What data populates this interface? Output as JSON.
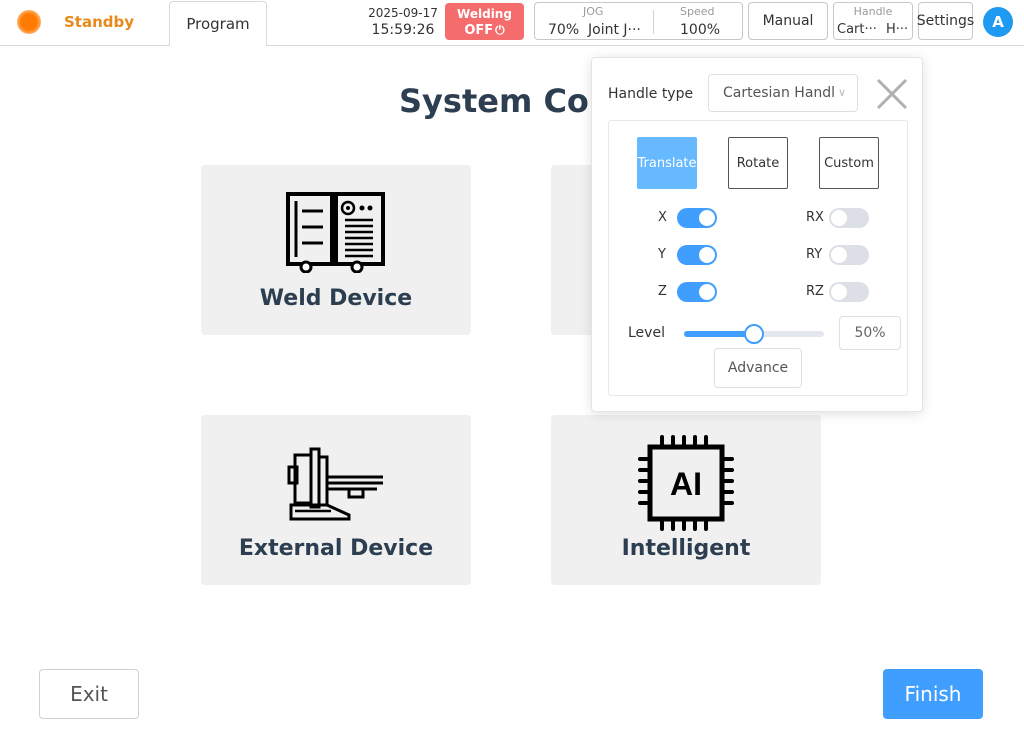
{
  "topbar": {
    "status": "Standby",
    "program_tab": "Program",
    "date": "2025-09-17",
    "time": "15:59:26",
    "welding": {
      "label": "Welding",
      "state": "OFF",
      "power_icon": "⏻"
    },
    "jog": {
      "caption": "JOG",
      "percent": "70%",
      "mode": "Joint J···"
    },
    "speed": {
      "caption": "Speed",
      "value": "100%"
    },
    "manual": "Manual",
    "handle": {
      "caption": "Handle",
      "v1": "Cart···",
      "v2": "H···"
    },
    "settings": "Settings",
    "avatar": "A"
  },
  "page": {
    "title": "System Conf",
    "cards": [
      {
        "label": "Weld Device",
        "icon": "weld-device-icon"
      },
      {
        "label": "External Device",
        "icon": "external-device-icon"
      },
      {
        "label": "Intelligent",
        "icon": "ai-chip-icon",
        "icon_text": "AI"
      }
    ],
    "exit": "Exit",
    "finish": "Finish"
  },
  "popover": {
    "handle_type_label": "Handle type",
    "handle_type_value": "Cartesian Handl",
    "modes": [
      "Translate",
      "Rotate",
      "Custom"
    ],
    "active_mode": "Translate",
    "axes_left": [
      {
        "label": "X",
        "on": true
      },
      {
        "label": "Y",
        "on": true
      },
      {
        "label": "Z",
        "on": true
      }
    ],
    "axes_right": [
      {
        "label": "RX",
        "on": false
      },
      {
        "label": "RY",
        "on": false
      },
      {
        "label": "RZ",
        "on": false
      }
    ],
    "level_label": "Level",
    "level_value": "50%",
    "level_fraction": 0.5,
    "advance": "Advance"
  },
  "colors": {
    "accent": "#409eff",
    "status_orange": "#e88a1a",
    "welding_red": "#f56c6c",
    "title": "#2c3e50"
  }
}
